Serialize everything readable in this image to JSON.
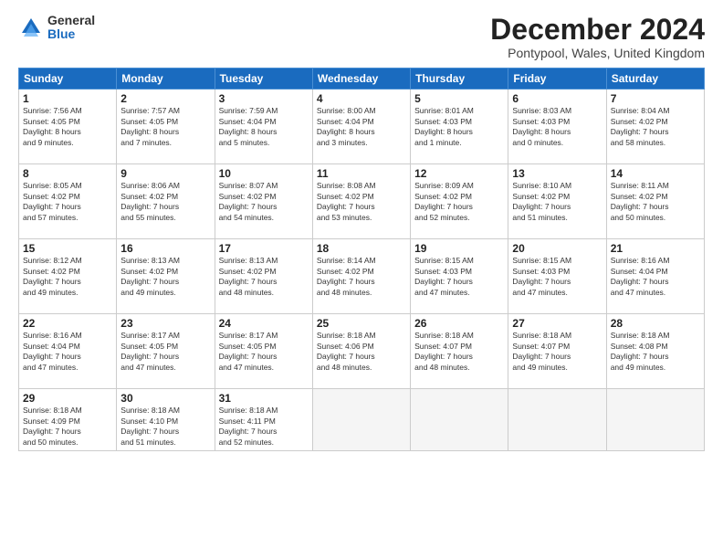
{
  "logo": {
    "general": "General",
    "blue": "Blue"
  },
  "header": {
    "month_year": "December 2024",
    "location": "Pontypool, Wales, United Kingdom"
  },
  "days_of_week": [
    "Sunday",
    "Monday",
    "Tuesday",
    "Wednesday",
    "Thursday",
    "Friday",
    "Saturday"
  ],
  "weeks": [
    [
      {
        "day": "1",
        "info": "Sunrise: 7:56 AM\nSunset: 4:05 PM\nDaylight: 8 hours\nand 9 minutes."
      },
      {
        "day": "2",
        "info": "Sunrise: 7:57 AM\nSunset: 4:05 PM\nDaylight: 8 hours\nand 7 minutes."
      },
      {
        "day": "3",
        "info": "Sunrise: 7:59 AM\nSunset: 4:04 PM\nDaylight: 8 hours\nand 5 minutes."
      },
      {
        "day": "4",
        "info": "Sunrise: 8:00 AM\nSunset: 4:04 PM\nDaylight: 8 hours\nand 3 minutes."
      },
      {
        "day": "5",
        "info": "Sunrise: 8:01 AM\nSunset: 4:03 PM\nDaylight: 8 hours\nand 1 minute."
      },
      {
        "day": "6",
        "info": "Sunrise: 8:03 AM\nSunset: 4:03 PM\nDaylight: 8 hours\nand 0 minutes."
      },
      {
        "day": "7",
        "info": "Sunrise: 8:04 AM\nSunset: 4:02 PM\nDaylight: 7 hours\nand 58 minutes."
      }
    ],
    [
      {
        "day": "8",
        "info": "Sunrise: 8:05 AM\nSunset: 4:02 PM\nDaylight: 7 hours\nand 57 minutes."
      },
      {
        "day": "9",
        "info": "Sunrise: 8:06 AM\nSunset: 4:02 PM\nDaylight: 7 hours\nand 55 minutes."
      },
      {
        "day": "10",
        "info": "Sunrise: 8:07 AM\nSunset: 4:02 PM\nDaylight: 7 hours\nand 54 minutes."
      },
      {
        "day": "11",
        "info": "Sunrise: 8:08 AM\nSunset: 4:02 PM\nDaylight: 7 hours\nand 53 minutes."
      },
      {
        "day": "12",
        "info": "Sunrise: 8:09 AM\nSunset: 4:02 PM\nDaylight: 7 hours\nand 52 minutes."
      },
      {
        "day": "13",
        "info": "Sunrise: 8:10 AM\nSunset: 4:02 PM\nDaylight: 7 hours\nand 51 minutes."
      },
      {
        "day": "14",
        "info": "Sunrise: 8:11 AM\nSunset: 4:02 PM\nDaylight: 7 hours\nand 50 minutes."
      }
    ],
    [
      {
        "day": "15",
        "info": "Sunrise: 8:12 AM\nSunset: 4:02 PM\nDaylight: 7 hours\nand 49 minutes."
      },
      {
        "day": "16",
        "info": "Sunrise: 8:13 AM\nSunset: 4:02 PM\nDaylight: 7 hours\nand 49 minutes."
      },
      {
        "day": "17",
        "info": "Sunrise: 8:13 AM\nSunset: 4:02 PM\nDaylight: 7 hours\nand 48 minutes."
      },
      {
        "day": "18",
        "info": "Sunrise: 8:14 AM\nSunset: 4:02 PM\nDaylight: 7 hours\nand 48 minutes."
      },
      {
        "day": "19",
        "info": "Sunrise: 8:15 AM\nSunset: 4:03 PM\nDaylight: 7 hours\nand 47 minutes."
      },
      {
        "day": "20",
        "info": "Sunrise: 8:15 AM\nSunset: 4:03 PM\nDaylight: 7 hours\nand 47 minutes."
      },
      {
        "day": "21",
        "info": "Sunrise: 8:16 AM\nSunset: 4:04 PM\nDaylight: 7 hours\nand 47 minutes."
      }
    ],
    [
      {
        "day": "22",
        "info": "Sunrise: 8:16 AM\nSunset: 4:04 PM\nDaylight: 7 hours\nand 47 minutes."
      },
      {
        "day": "23",
        "info": "Sunrise: 8:17 AM\nSunset: 4:05 PM\nDaylight: 7 hours\nand 47 minutes."
      },
      {
        "day": "24",
        "info": "Sunrise: 8:17 AM\nSunset: 4:05 PM\nDaylight: 7 hours\nand 47 minutes."
      },
      {
        "day": "25",
        "info": "Sunrise: 8:18 AM\nSunset: 4:06 PM\nDaylight: 7 hours\nand 48 minutes."
      },
      {
        "day": "26",
        "info": "Sunrise: 8:18 AM\nSunset: 4:07 PM\nDaylight: 7 hours\nand 48 minutes."
      },
      {
        "day": "27",
        "info": "Sunrise: 8:18 AM\nSunset: 4:07 PM\nDaylight: 7 hours\nand 49 minutes."
      },
      {
        "day": "28",
        "info": "Sunrise: 8:18 AM\nSunset: 4:08 PM\nDaylight: 7 hours\nand 49 minutes."
      }
    ],
    [
      {
        "day": "29",
        "info": "Sunrise: 8:18 AM\nSunset: 4:09 PM\nDaylight: 7 hours\nand 50 minutes."
      },
      {
        "day": "30",
        "info": "Sunrise: 8:18 AM\nSunset: 4:10 PM\nDaylight: 7 hours\nand 51 minutes."
      },
      {
        "day": "31",
        "info": "Sunrise: 8:18 AM\nSunset: 4:11 PM\nDaylight: 7 hours\nand 52 minutes."
      },
      {
        "day": "",
        "info": ""
      },
      {
        "day": "",
        "info": ""
      },
      {
        "day": "",
        "info": ""
      },
      {
        "day": "",
        "info": ""
      }
    ]
  ]
}
